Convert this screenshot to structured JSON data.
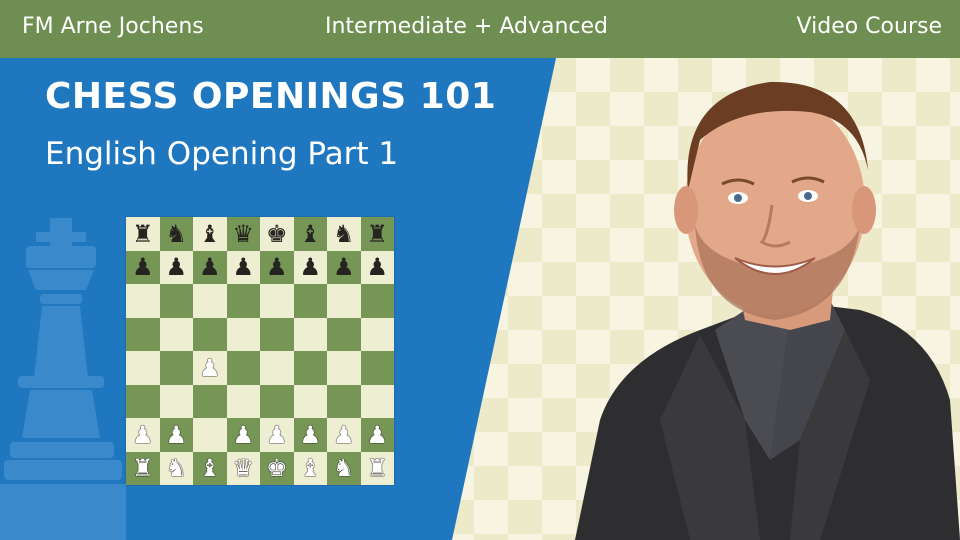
{
  "header": {
    "author": "FM Arne Jochens",
    "level": "Intermediate + Advanced",
    "format": "Video Course"
  },
  "course": {
    "title": "CHESS OPENINGS 101",
    "subtitle": "English Opening Part 1"
  },
  "colors": {
    "top_bar": "#6f8f52",
    "panel_blue": "#1f77bf",
    "board_light": "#eeeed2",
    "board_dark": "#769656",
    "checker_light": "#f7f5e2",
    "checker_dark": "#eceac8"
  },
  "board": {
    "position": [
      [
        "r",
        "n",
        "b",
        "q",
        "k",
        "b",
        "n",
        "r"
      ],
      [
        "p",
        "p",
        "p",
        "p",
        "p",
        "p",
        "p",
        "p"
      ],
      [
        "",
        "",
        "",
        "",
        "",
        "",
        "",
        ""
      ],
      [
        "",
        "",
        "",
        "",
        "",
        "",
        "",
        ""
      ],
      [
        "",
        "",
        "P",
        "",
        "",
        "",
        "",
        ""
      ],
      [
        "",
        "",
        "",
        "",
        "",
        "",
        "",
        ""
      ],
      [
        "P",
        "P",
        "",
        "P",
        "P",
        "P",
        "P",
        "P"
      ],
      [
        "R",
        "N",
        "B",
        "Q",
        "K",
        "B",
        "N",
        "R"
      ]
    ]
  },
  "icons": {
    "background_piece": "king-silhouette-icon",
    "presenter": "presenter-portrait"
  }
}
